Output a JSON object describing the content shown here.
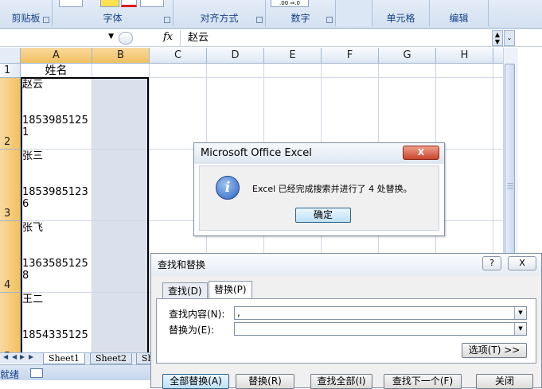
{
  "ribbon": {
    "groups": [
      "剪贴板",
      "字体",
      "对齐方式",
      "数字",
      "单元格",
      "编辑"
    ],
    "number_format_btn": ".00 ⇒.0"
  },
  "formula_bar": {
    "namebox_value": "",
    "fx_label": "fx",
    "content": "赵云"
  },
  "columns": [
    "A",
    "B",
    "C",
    "D",
    "E",
    "F",
    "G",
    "H"
  ],
  "rows": [
    {
      "num": "1",
      "a": "姓名"
    },
    {
      "num": "2",
      "a": "赵云\n\n\n1853985125\n1"
    },
    {
      "num": "3",
      "a": "张三\n\n\n1853985123\n6"
    },
    {
      "num": "4",
      "a": "张飞\n\n\n1363585125\n8"
    },
    {
      "num": "5",
      "a": "王二\n\n\n1854335125"
    }
  ],
  "sheet_tabs": [
    "Sheet1",
    "Sheet2",
    "Sh"
  ],
  "status": {
    "text": "就绪"
  },
  "alert": {
    "title": "Microsoft Office Excel",
    "close": "X",
    "message": "Excel 已经完成搜索并进行了 4 处替换。",
    "ok": "确定"
  },
  "find_replace": {
    "title": "查找和替换",
    "help": "?",
    "close": "X",
    "tab_find": "查找(D)",
    "tab_replace": "替换(P)",
    "find_label": "查找内容(N):",
    "find_value": ",",
    "replace_label": "替换为(E):",
    "replace_value": "",
    "options": "选项(T) >>",
    "btn_replace_all": "全部替换(A)",
    "btn_replace": "替换(R)",
    "btn_find_all": "查找全部(I)",
    "btn_find_next": "查找下一个(F)",
    "btn_close": "关闭"
  }
}
